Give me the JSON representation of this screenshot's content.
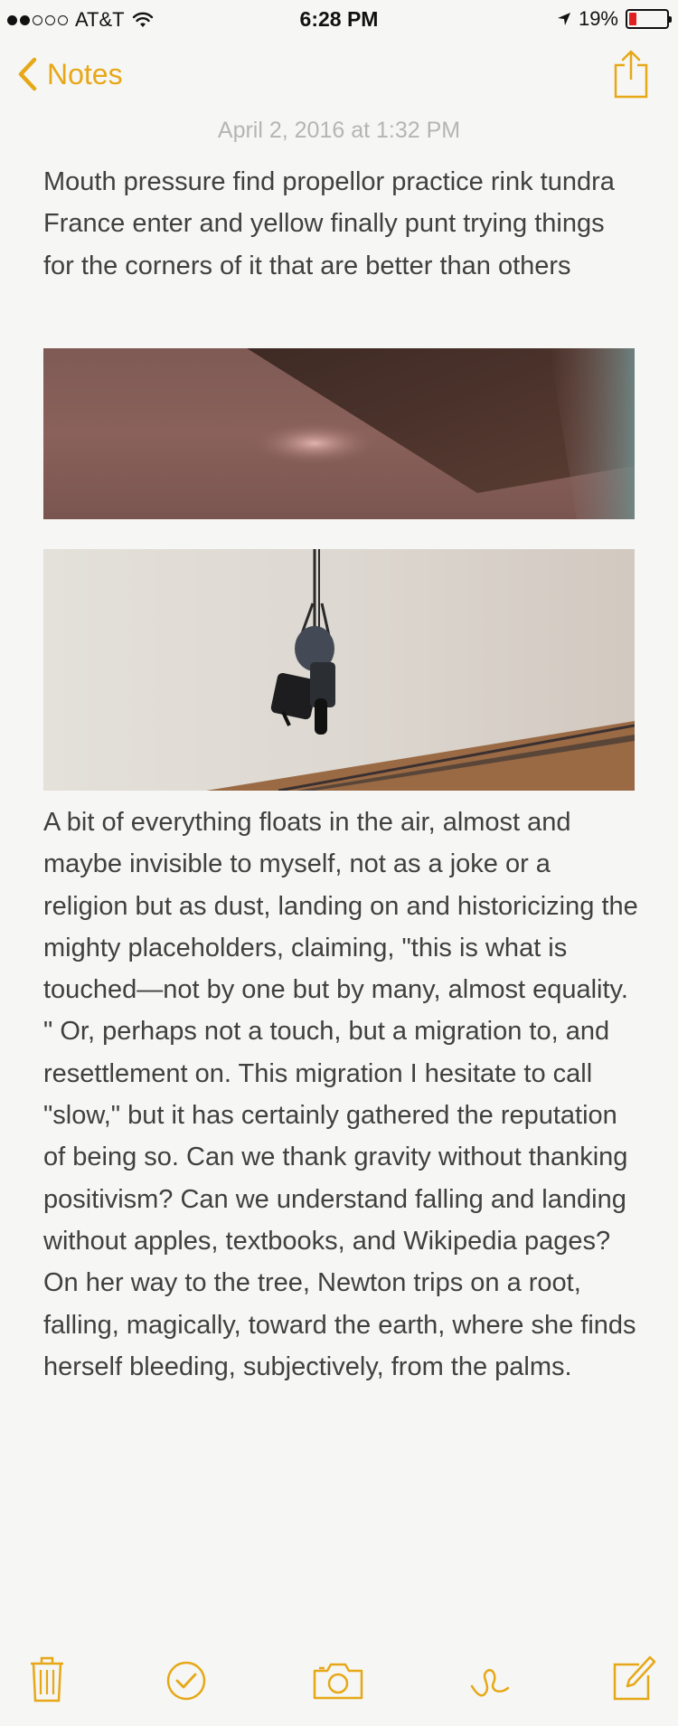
{
  "status_bar": {
    "carrier": "AT&T",
    "time": "6:28 PM",
    "battery_percent": "19%",
    "signal_bars_filled": 2,
    "signal_bars_total": 5
  },
  "nav": {
    "back_label": "Notes"
  },
  "note": {
    "date": "April 2, 2016 at 1:32 PM",
    "paragraph_1": "Mouth pressure find propellor practice rink tundra France enter and yellow finally punt trying things for the corners of it that are better than others",
    "paragraph_2": "A bit of everything floats in the air, almost and maybe invisible to myself, not as a joke or a religion but as dust, landing on and historicizing the mighty placeholders, claiming, \"this is what is touched—not by one but by many, almost equality. \" Or, perhaps not a touch, but a migration to, and resettlement on. This migration I hesitate to call \"slow,\" but it has certainly gathered the reputation of being so. Can we thank gravity without thanking positivism? Can we understand falling and landing without apples, textbooks, and Wikipedia pages? On her way to the tree, Newton trips on a root, falling, magically, toward the earth, where she finds herself bleeding, subjectively, from the palms."
  },
  "toolbar": {
    "items": [
      "trash-icon",
      "checklist-icon",
      "camera-icon",
      "sketch-icon",
      "compose-icon"
    ]
  },
  "colors": {
    "accent": "#e6a817",
    "background": "#f6f6f4",
    "text": "#404040",
    "date": "#b5b5b5",
    "battery_low": "#e02020"
  }
}
